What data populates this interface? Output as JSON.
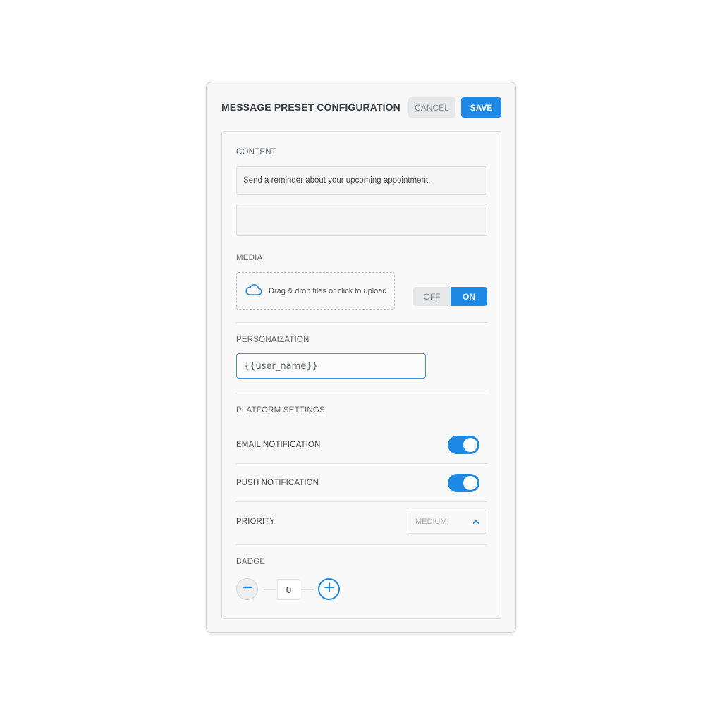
{
  "header": {
    "title": "MESSAGE PRESET CONFIGURATION",
    "cancel_label": "CANCEL",
    "save_label": "SAVE"
  },
  "content": {
    "label": "CONTENT",
    "message_value": "Send a reminder about your upcoming appointment.",
    "secondary_value": ""
  },
  "media": {
    "label": "MEDIA",
    "upload_text": "Drag & drop files or click to upload.",
    "toggle_off_label": "OFF",
    "toggle_on_label": "ON",
    "selected": "ON"
  },
  "personalization": {
    "label": "PERSONAIZATION",
    "value": "{{user_name}}"
  },
  "platform": {
    "label": "PLATFORM SETTINGS",
    "email_label": "EMAIL NOTIFICATION",
    "email_enabled": true,
    "push_label": "PUSH NOTIFICATION",
    "push_enabled": true,
    "priority_label": "PRIORITY",
    "priority_value": "MEDIUM"
  },
  "badge": {
    "label": "BADGE",
    "value": "0"
  },
  "colors": {
    "accent": "#1e88e5",
    "background": "#f7f7f7",
    "border": "#cfd3d6"
  },
  "icons": {
    "upload": "cloud-icon",
    "priority_chevron": "chevron-up-icon",
    "decrement": "minus-icon",
    "increment": "plus-icon"
  }
}
